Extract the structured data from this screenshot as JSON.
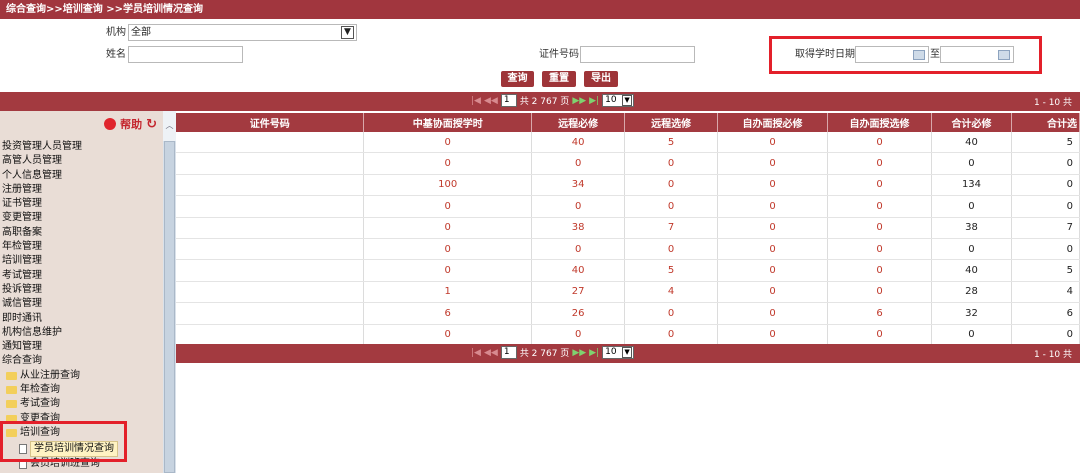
{
  "breadcrumb": "综合查询>>培训查询 >>学员培训情况查询",
  "form": {
    "org_label": "机构",
    "org_value": "全部",
    "name_label": "姓名",
    "name_value": "",
    "cert_label": "证件号码",
    "cert_value": "",
    "date_label": "取得学时日期",
    "date_sep": "至",
    "date_from": "",
    "date_to": ""
  },
  "buttons": {
    "query": "查询",
    "reset": "重置",
    "export": "导出"
  },
  "pager": {
    "page": "1",
    "total": "共 2 767 页",
    "page_size": "10",
    "range": "1 - 10  共"
  },
  "sidebar": {
    "help": "帮助",
    "items": [
      "投资管理人员管理",
      "高管人员管理",
      "个人信息管理",
      "注册管理",
      "证书管理",
      "变更管理",
      "高职备案",
      "年检管理",
      "培训管理",
      "考试管理",
      "投诉管理",
      "诚信管理",
      "即时通讯",
      "机构信息维护",
      "通知管理",
      "综合查询"
    ],
    "sub_items": [
      "从业注册查询",
      "年检查询",
      "考试查询",
      "变更查询",
      "培训查询"
    ],
    "leaf_items": [
      "学员培训情况查询",
      "会员培训班查询"
    ]
  },
  "table": {
    "columns": [
      "",
      "证件号码",
      "中基协面授学时",
      "远程必修",
      "远程选修",
      "自办面授必修",
      "自办面授选修",
      "合计必修",
      "合计选"
    ],
    "rows": [
      [
        "",
        "",
        "0",
        "40",
        "5",
        "0",
        "0",
        "40",
        "5"
      ],
      [
        "",
        "",
        "0",
        "0",
        "0",
        "0",
        "0",
        "0",
        "0"
      ],
      [
        "",
        "",
        "100",
        "34",
        "0",
        "0",
        "0",
        "134",
        "0"
      ],
      [
        "",
        "",
        "0",
        "0",
        "0",
        "0",
        "0",
        "0",
        "0"
      ],
      [
        "",
        "",
        "0",
        "38",
        "7",
        "0",
        "0",
        "38",
        "7"
      ],
      [
        "",
        "",
        "0",
        "0",
        "0",
        "0",
        "0",
        "0",
        "0"
      ],
      [
        "",
        "",
        "0",
        "40",
        "5",
        "0",
        "0",
        "40",
        "5"
      ],
      [
        "",
        "",
        "1",
        "27",
        "4",
        "0",
        "0",
        "28",
        "4"
      ],
      [
        "",
        "",
        "6",
        "26",
        "0",
        "0",
        "6",
        "32",
        "6"
      ],
      [
        "",
        "",
        "0",
        "0",
        "0",
        "0",
        "0",
        "0",
        "0"
      ]
    ]
  }
}
